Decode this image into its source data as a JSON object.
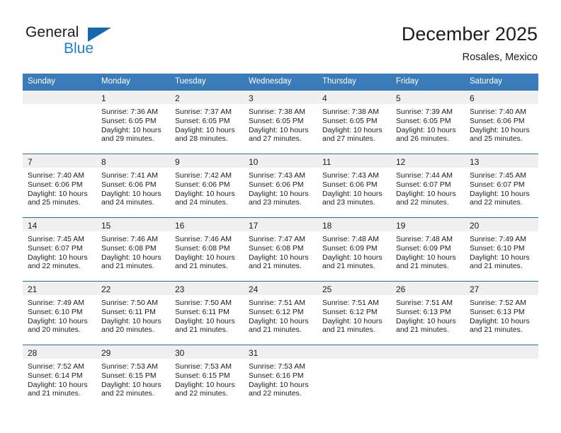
{
  "brand": {
    "name_top": "General",
    "name_bottom": "Blue",
    "triangle_color": "#1567b2",
    "blue_color": "#1f7fd4"
  },
  "header": {
    "month_title": "December 2025",
    "location": "Rosales, Mexico"
  },
  "theme": {
    "header_bg": "#3a7cba",
    "row_border": "#2f6ea5",
    "daynum_band_bg": "#f0f0f0"
  },
  "weekdays": [
    "Sunday",
    "Monday",
    "Tuesday",
    "Wednesday",
    "Thursday",
    "Friday",
    "Saturday"
  ],
  "weeks": [
    [
      {
        "day": "",
        "sunrise": "",
        "sunset": "",
        "daylight1": "",
        "daylight2": ""
      },
      {
        "day": "1",
        "sunrise": "Sunrise: 7:36 AM",
        "sunset": "Sunset: 6:05 PM",
        "daylight1": "Daylight: 10 hours",
        "daylight2": "and 29 minutes."
      },
      {
        "day": "2",
        "sunrise": "Sunrise: 7:37 AM",
        "sunset": "Sunset: 6:05 PM",
        "daylight1": "Daylight: 10 hours",
        "daylight2": "and 28 minutes."
      },
      {
        "day": "3",
        "sunrise": "Sunrise: 7:38 AM",
        "sunset": "Sunset: 6:05 PM",
        "daylight1": "Daylight: 10 hours",
        "daylight2": "and 27 minutes."
      },
      {
        "day": "4",
        "sunrise": "Sunrise: 7:38 AM",
        "sunset": "Sunset: 6:05 PM",
        "daylight1": "Daylight: 10 hours",
        "daylight2": "and 27 minutes."
      },
      {
        "day": "5",
        "sunrise": "Sunrise: 7:39 AM",
        "sunset": "Sunset: 6:05 PM",
        "daylight1": "Daylight: 10 hours",
        "daylight2": "and 26 minutes."
      },
      {
        "day": "6",
        "sunrise": "Sunrise: 7:40 AM",
        "sunset": "Sunset: 6:06 PM",
        "daylight1": "Daylight: 10 hours",
        "daylight2": "and 25 minutes."
      }
    ],
    [
      {
        "day": "7",
        "sunrise": "Sunrise: 7:40 AM",
        "sunset": "Sunset: 6:06 PM",
        "daylight1": "Daylight: 10 hours",
        "daylight2": "and 25 minutes."
      },
      {
        "day": "8",
        "sunrise": "Sunrise: 7:41 AM",
        "sunset": "Sunset: 6:06 PM",
        "daylight1": "Daylight: 10 hours",
        "daylight2": "and 24 minutes."
      },
      {
        "day": "9",
        "sunrise": "Sunrise: 7:42 AM",
        "sunset": "Sunset: 6:06 PM",
        "daylight1": "Daylight: 10 hours",
        "daylight2": "and 24 minutes."
      },
      {
        "day": "10",
        "sunrise": "Sunrise: 7:43 AM",
        "sunset": "Sunset: 6:06 PM",
        "daylight1": "Daylight: 10 hours",
        "daylight2": "and 23 minutes."
      },
      {
        "day": "11",
        "sunrise": "Sunrise: 7:43 AM",
        "sunset": "Sunset: 6:06 PM",
        "daylight1": "Daylight: 10 hours",
        "daylight2": "and 23 minutes."
      },
      {
        "day": "12",
        "sunrise": "Sunrise: 7:44 AM",
        "sunset": "Sunset: 6:07 PM",
        "daylight1": "Daylight: 10 hours",
        "daylight2": "and 22 minutes."
      },
      {
        "day": "13",
        "sunrise": "Sunrise: 7:45 AM",
        "sunset": "Sunset: 6:07 PM",
        "daylight1": "Daylight: 10 hours",
        "daylight2": "and 22 minutes."
      }
    ],
    [
      {
        "day": "14",
        "sunrise": "Sunrise: 7:45 AM",
        "sunset": "Sunset: 6:07 PM",
        "daylight1": "Daylight: 10 hours",
        "daylight2": "and 22 minutes."
      },
      {
        "day": "15",
        "sunrise": "Sunrise: 7:46 AM",
        "sunset": "Sunset: 6:08 PM",
        "daylight1": "Daylight: 10 hours",
        "daylight2": "and 21 minutes."
      },
      {
        "day": "16",
        "sunrise": "Sunrise: 7:46 AM",
        "sunset": "Sunset: 6:08 PM",
        "daylight1": "Daylight: 10 hours",
        "daylight2": "and 21 minutes."
      },
      {
        "day": "17",
        "sunrise": "Sunrise: 7:47 AM",
        "sunset": "Sunset: 6:08 PM",
        "daylight1": "Daylight: 10 hours",
        "daylight2": "and 21 minutes."
      },
      {
        "day": "18",
        "sunrise": "Sunrise: 7:48 AM",
        "sunset": "Sunset: 6:09 PM",
        "daylight1": "Daylight: 10 hours",
        "daylight2": "and 21 minutes."
      },
      {
        "day": "19",
        "sunrise": "Sunrise: 7:48 AM",
        "sunset": "Sunset: 6:09 PM",
        "daylight1": "Daylight: 10 hours",
        "daylight2": "and 21 minutes."
      },
      {
        "day": "20",
        "sunrise": "Sunrise: 7:49 AM",
        "sunset": "Sunset: 6:10 PM",
        "daylight1": "Daylight: 10 hours",
        "daylight2": "and 21 minutes."
      }
    ],
    [
      {
        "day": "21",
        "sunrise": "Sunrise: 7:49 AM",
        "sunset": "Sunset: 6:10 PM",
        "daylight1": "Daylight: 10 hours",
        "daylight2": "and 20 minutes."
      },
      {
        "day": "22",
        "sunrise": "Sunrise: 7:50 AM",
        "sunset": "Sunset: 6:11 PM",
        "daylight1": "Daylight: 10 hours",
        "daylight2": "and 20 minutes."
      },
      {
        "day": "23",
        "sunrise": "Sunrise: 7:50 AM",
        "sunset": "Sunset: 6:11 PM",
        "daylight1": "Daylight: 10 hours",
        "daylight2": "and 21 minutes."
      },
      {
        "day": "24",
        "sunrise": "Sunrise: 7:51 AM",
        "sunset": "Sunset: 6:12 PM",
        "daylight1": "Daylight: 10 hours",
        "daylight2": "and 21 minutes."
      },
      {
        "day": "25",
        "sunrise": "Sunrise: 7:51 AM",
        "sunset": "Sunset: 6:12 PM",
        "daylight1": "Daylight: 10 hours",
        "daylight2": "and 21 minutes."
      },
      {
        "day": "26",
        "sunrise": "Sunrise: 7:51 AM",
        "sunset": "Sunset: 6:13 PM",
        "daylight1": "Daylight: 10 hours",
        "daylight2": "and 21 minutes."
      },
      {
        "day": "27",
        "sunrise": "Sunrise: 7:52 AM",
        "sunset": "Sunset: 6:13 PM",
        "daylight1": "Daylight: 10 hours",
        "daylight2": "and 21 minutes."
      }
    ],
    [
      {
        "day": "28",
        "sunrise": "Sunrise: 7:52 AM",
        "sunset": "Sunset: 6:14 PM",
        "daylight1": "Daylight: 10 hours",
        "daylight2": "and 21 minutes."
      },
      {
        "day": "29",
        "sunrise": "Sunrise: 7:53 AM",
        "sunset": "Sunset: 6:15 PM",
        "daylight1": "Daylight: 10 hours",
        "daylight2": "and 22 minutes."
      },
      {
        "day": "30",
        "sunrise": "Sunrise: 7:53 AM",
        "sunset": "Sunset: 6:15 PM",
        "daylight1": "Daylight: 10 hours",
        "daylight2": "and 22 minutes."
      },
      {
        "day": "31",
        "sunrise": "Sunrise: 7:53 AM",
        "sunset": "Sunset: 6:16 PM",
        "daylight1": "Daylight: 10 hours",
        "daylight2": "and 22 minutes."
      },
      {
        "day": "",
        "sunrise": "",
        "sunset": "",
        "daylight1": "",
        "daylight2": ""
      },
      {
        "day": "",
        "sunrise": "",
        "sunset": "",
        "daylight1": "",
        "daylight2": ""
      },
      {
        "day": "",
        "sunrise": "",
        "sunset": "",
        "daylight1": "",
        "daylight2": ""
      }
    ]
  ]
}
